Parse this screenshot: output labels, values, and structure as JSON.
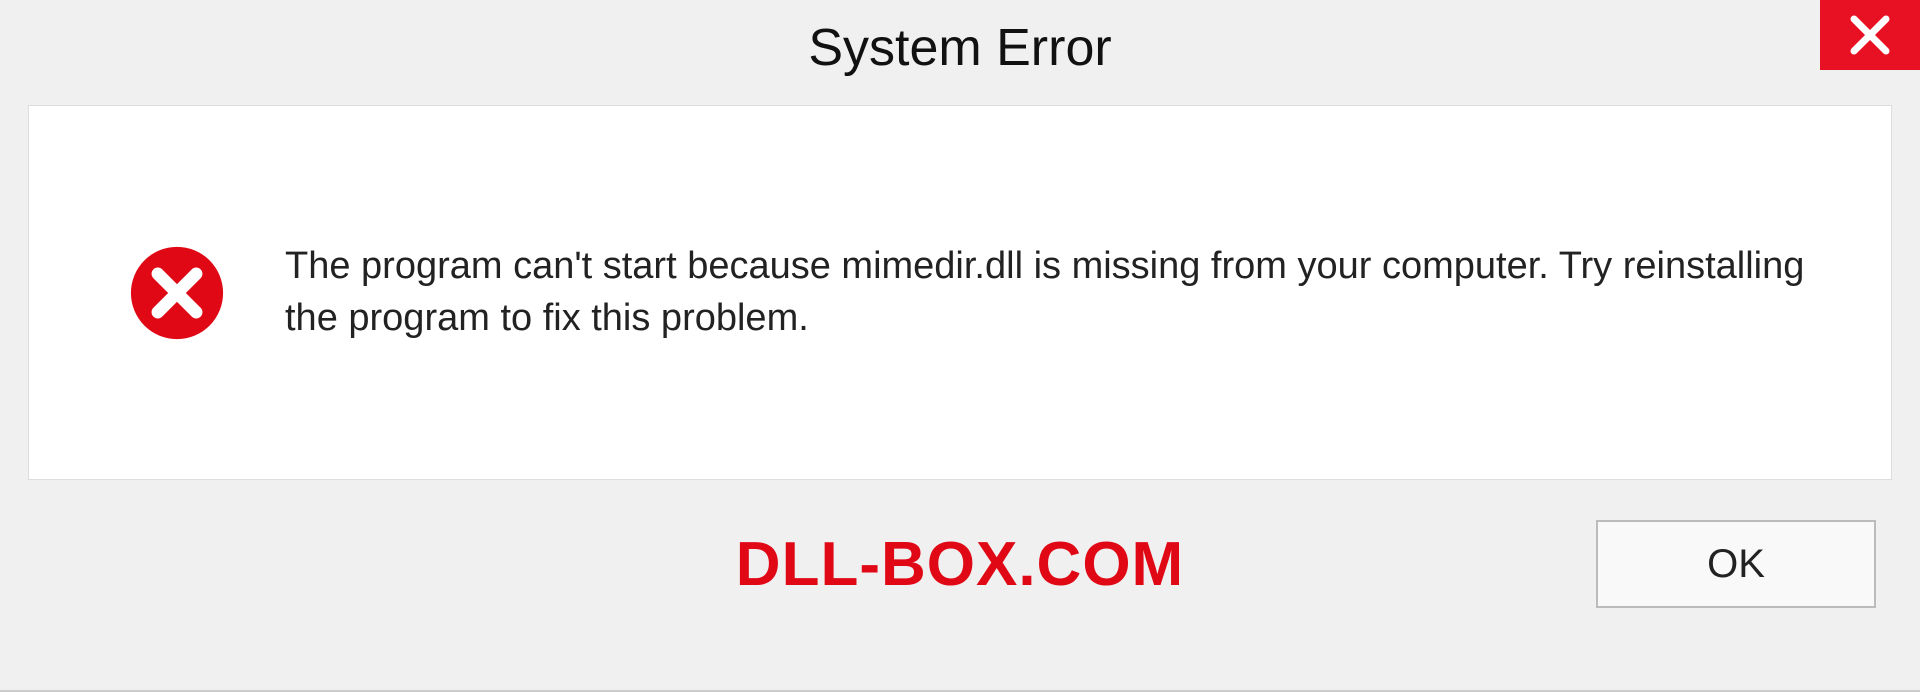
{
  "dialog": {
    "title": "System Error",
    "message": "The program can't start because mimedir.dll is missing from your computer. Try reinstalling the program to fix this problem.",
    "ok_label": "OK"
  },
  "watermark": "DLL-BOX.COM"
}
